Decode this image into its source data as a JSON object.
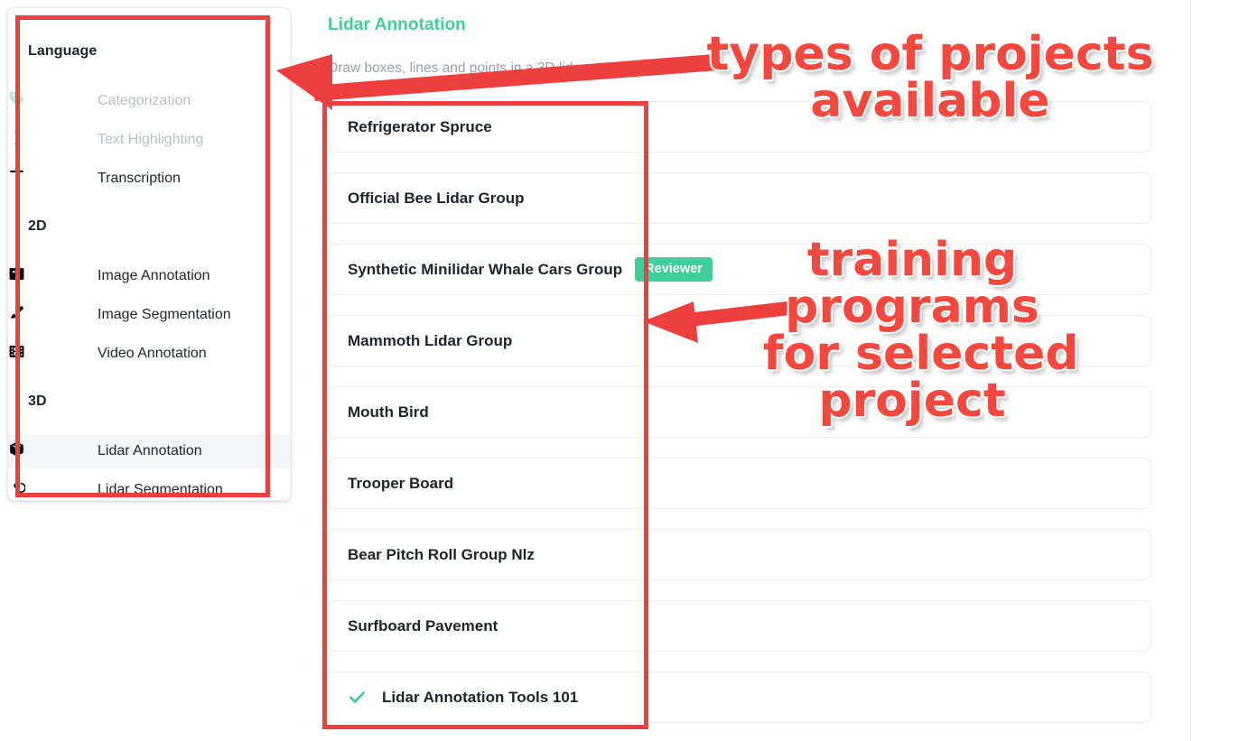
{
  "sidebar": {
    "groups": [
      {
        "title": "Language",
        "items": [
          {
            "label": "Categorization",
            "icon": "tag-icon",
            "disabled": true,
            "selected": false
          },
          {
            "label": "Text Highlighting",
            "icon": "text-cursor-icon",
            "disabled": true,
            "selected": false
          },
          {
            "label": "Transcription",
            "icon": "letter-t-icon",
            "disabled": false,
            "selected": false
          }
        ]
      },
      {
        "title": "2D",
        "items": [
          {
            "label": "Image Annotation",
            "icon": "image-icon",
            "disabled": false,
            "selected": false
          },
          {
            "label": "Image Segmentation",
            "icon": "paintbrush-icon",
            "disabled": false,
            "selected": false
          },
          {
            "label": "Video Annotation",
            "icon": "film-strip-icon",
            "disabled": false,
            "selected": false
          }
        ]
      },
      {
        "title": "3D",
        "items": [
          {
            "label": "Lidar Annotation",
            "icon": "cube-icon",
            "disabled": false,
            "selected": true
          },
          {
            "label": "Lidar Segmentation",
            "icon": "spiral-icon",
            "disabled": false,
            "selected": false
          }
        ]
      }
    ]
  },
  "main": {
    "title": "Lidar Annotation",
    "subtitle": "Draw boxes, lines and points in a 3D lidar scene",
    "projects": [
      {
        "name": "Refrigerator Spruce",
        "badge": null,
        "completed": false
      },
      {
        "name": "Official Bee Lidar Group",
        "badge": null,
        "completed": false
      },
      {
        "name": "Synthetic Minilidar Whale Cars Group",
        "badge": "Reviewer",
        "completed": false
      },
      {
        "name": "Mammoth Lidar Group",
        "badge": null,
        "completed": false
      },
      {
        "name": "Mouth Bird",
        "badge": null,
        "completed": false
      },
      {
        "name": "Trooper Board",
        "badge": null,
        "completed": false
      },
      {
        "name": "Bear Pitch Roll Group Nlz",
        "badge": null,
        "completed": false
      },
      {
        "name": "Surfboard Pavement",
        "badge": null,
        "completed": false
      },
      {
        "name": "Lidar Annotation Tools 101",
        "badge": null,
        "completed": true
      }
    ]
  },
  "annotations": {
    "callout_1": "types of projects\navailable",
    "callout_2": "training\nprograms\nfor selected\nproject",
    "color": "#f4473e"
  },
  "colors": {
    "accent_green": "#3ecf9a",
    "badge_green": "#3ecf9a",
    "annotation_red": "#f4473e",
    "text_primary": "#1f2328",
    "text_muted": "#98a0a8",
    "disabled_text": "#b9bec4"
  }
}
